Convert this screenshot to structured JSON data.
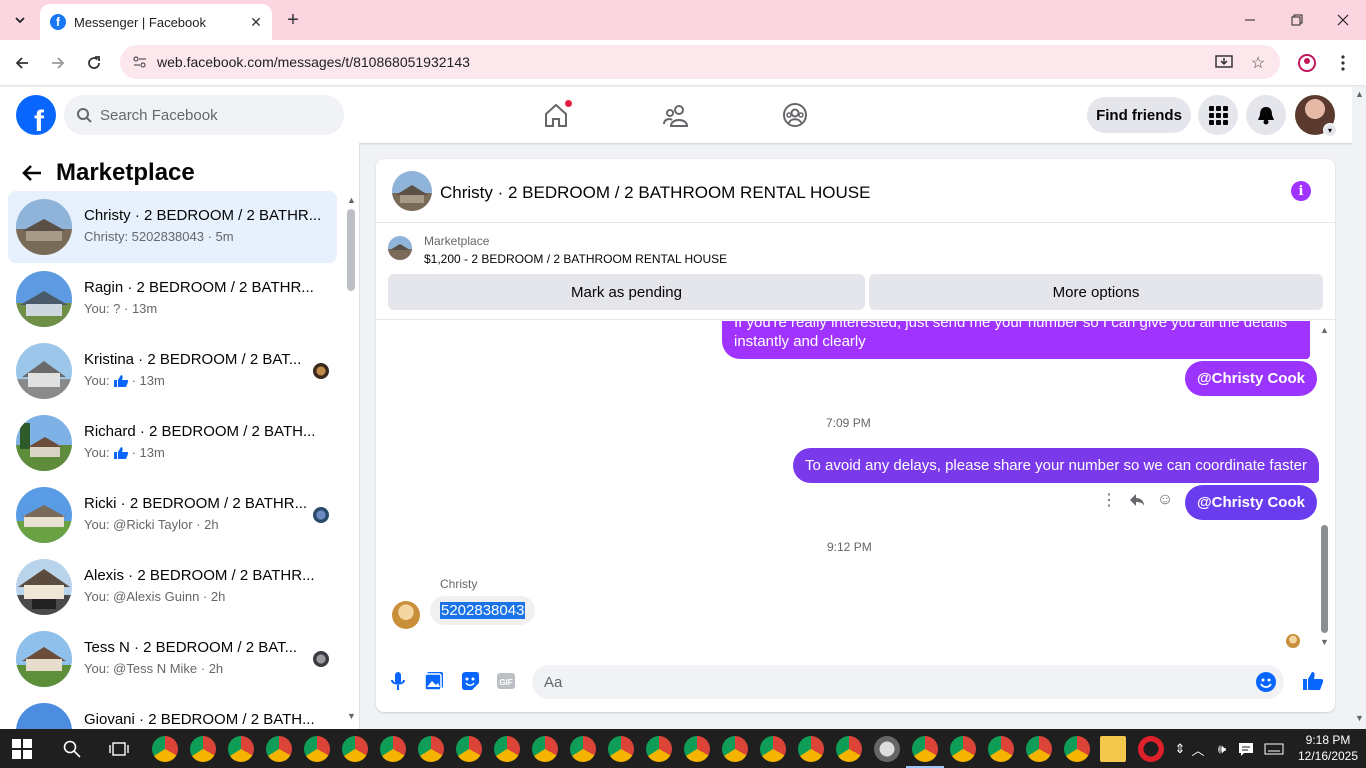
{
  "browser": {
    "tab_title": "Messenger | Facebook",
    "url": "web.facebook.com/messages/t/810868051932143"
  },
  "header": {
    "search_placeholder": "Search Facebook",
    "find_friends": "Find friends",
    "brand_color": "#0866ff"
  },
  "sidebar": {
    "title": "Marketplace",
    "conversations": [
      {
        "name": "Christy · 2 BEDROOM / 2 BATHR...",
        "sub": "Christy: 5202838043 · 5m",
        "active": true
      },
      {
        "name": "Ragin · 2 BEDROOM / 2 BATHR...",
        "sub": "You: ? · 13m"
      },
      {
        "name": "Kristina · 2 BEDROOM / 2 BAT...",
        "sub_prefix": "You:",
        "sub_suffix": "· 13m"
      },
      {
        "name": "Richard · 2 BEDROOM / 2 BATH...",
        "sub_prefix": "You:",
        "sub_suffix": "· 13m"
      },
      {
        "name": "Ricki · 2 BEDROOM / 2 BATHR...",
        "sub": "You: @Ricki Taylor · 2h"
      },
      {
        "name": "Alexis · 2 BEDROOM / 2 BATHR...",
        "sub": "You: @Alexis Guinn · 2h"
      },
      {
        "name": "Tess N · 2 BEDROOM / 2 BAT...",
        "sub": "You: @Tess N Mike · 2h"
      },
      {
        "name": "Giovani · 2 BEDROOM / 2 BATH...",
        "sub": ""
      }
    ]
  },
  "chat": {
    "title": "Christy · 2 BEDROOM / 2 BATHROOM RENTAL HOUSE",
    "listing_source": "Marketplace",
    "listing_title": "$1,200 - 2 BEDROOM / 2 BATHROOM RENTAL HOUSE",
    "mark_pending": "Mark as pending",
    "more_options": "More options",
    "messages": {
      "m1": "If you're really interested, just send me your  number so I can give you all the details instantly and clearly",
      "mention": "@Christy Cook",
      "time1": "7:09 PM",
      "m2": "To avoid any delays, please share your number so we can coordinate faster",
      "mention2": "@Christy Cook",
      "time2": "9:12 PM",
      "sender": "Christy",
      "incoming": "5202838043"
    },
    "composer_placeholder": "Aa",
    "bubble_color_1": "#a033ff",
    "bubble_color_2": "#7b39ec"
  },
  "taskbar": {
    "time": "9:18 PM",
    "date": "12/16/2025"
  }
}
